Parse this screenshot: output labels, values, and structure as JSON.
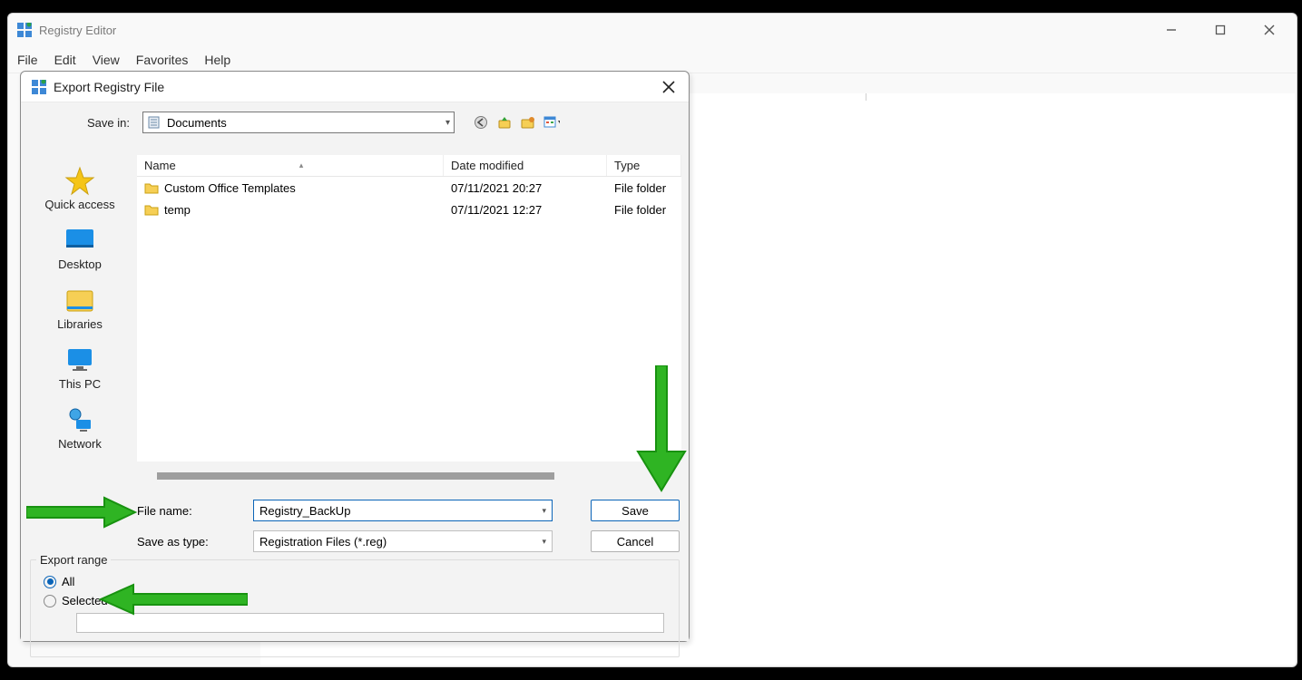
{
  "main_window": {
    "title": "Registry Editor",
    "menu": [
      "File",
      "Edit",
      "View",
      "Favorites",
      "Help"
    ]
  },
  "dialog": {
    "title": "Export Registry File",
    "save_in_label": "Save in:",
    "save_in_value": "Documents",
    "sidebar": [
      {
        "label": "Quick access"
      },
      {
        "label": "Desktop"
      },
      {
        "label": "Libraries"
      },
      {
        "label": "This PC"
      },
      {
        "label": "Network"
      }
    ],
    "columns": {
      "name": "Name",
      "date": "Date modified",
      "type": "Type"
    },
    "rows": [
      {
        "name": "Custom Office Templates",
        "date": "07/11/2021 20:27",
        "type": "File folder"
      },
      {
        "name": "temp",
        "date": "07/11/2021 12:27",
        "type": "File folder"
      }
    ],
    "file_name_label": "File name:",
    "file_name_value": "Registry_BackUp",
    "save_as_type_label": "Save as type:",
    "save_as_type_value": "Registration Files (*.reg)",
    "buttons": {
      "save": "Save",
      "cancel": "Cancel"
    },
    "export_range": {
      "legend": "Export range",
      "all": "All",
      "selected": "Selected branch",
      "selected_value": ""
    }
  }
}
